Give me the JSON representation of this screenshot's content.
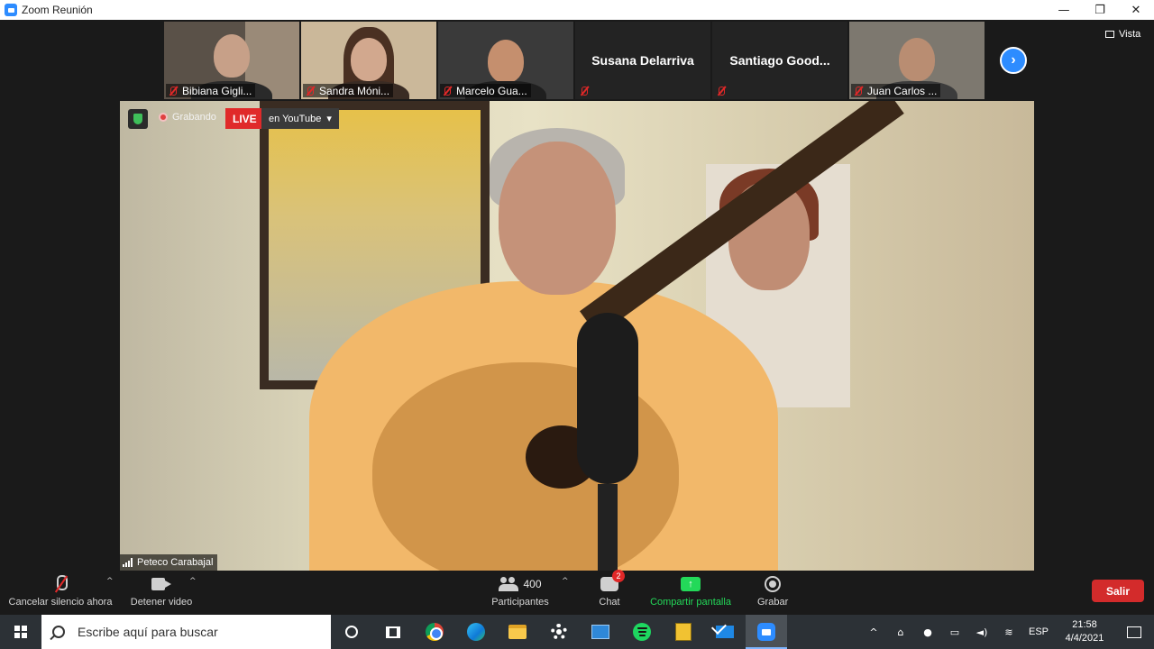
{
  "window": {
    "title": "Zoom Reunión",
    "controls": [
      "—",
      "❐",
      "✕"
    ]
  },
  "gallery": {
    "participants": [
      {
        "name": "Bibiana Gigli...",
        "muted": true,
        "video": true
      },
      {
        "name": "Sandra Móni...",
        "muted": true,
        "video": true
      },
      {
        "name": "Marcelo Gua...",
        "muted": true,
        "video": true
      },
      {
        "name": "Susana Delarriva",
        "muted": true,
        "video": false
      },
      {
        "name": "Santiago  Good...",
        "muted": true,
        "video": false
      },
      {
        "name": "Juan Carlos ...",
        "muted": true,
        "video": true
      }
    ],
    "next_label": "›",
    "view_label": "Vista"
  },
  "stage": {
    "recording_label": "Grabando",
    "live_label": "LIVE",
    "youtube_label": "en YouTube",
    "youtube_caret": "▾",
    "speaker_name": "Peteco Carabajal"
  },
  "toolbar": {
    "mute_label": "Cancelar silencio ahora",
    "video_label": "Detener video",
    "participants_label": "Participantes",
    "participants_count": "400",
    "chat_label": "Chat",
    "chat_badge": "2",
    "share_label": "Compartir pantalla",
    "share_glyph": "↑",
    "record_label": "Grabar",
    "leave_label": "Salir",
    "caret": "^",
    "colors": {
      "share": "#23d959",
      "leave": "#d32b2b",
      "badge": "#e02828"
    }
  },
  "taskbar": {
    "search_placeholder": "Escribe aquí para buscar",
    "apps": [
      "cortana-icon",
      "task-view-icon",
      "chrome-icon",
      "edge-icon",
      "file-explorer-icon",
      "settings-icon",
      "photos-icon",
      "spotify-icon",
      "sticky-notes-icon",
      "mail-icon",
      "zoom-icon"
    ],
    "tray": {
      "chevron": "^",
      "language": "ESP",
      "time": "21:58",
      "date": "4/4/2021"
    }
  }
}
